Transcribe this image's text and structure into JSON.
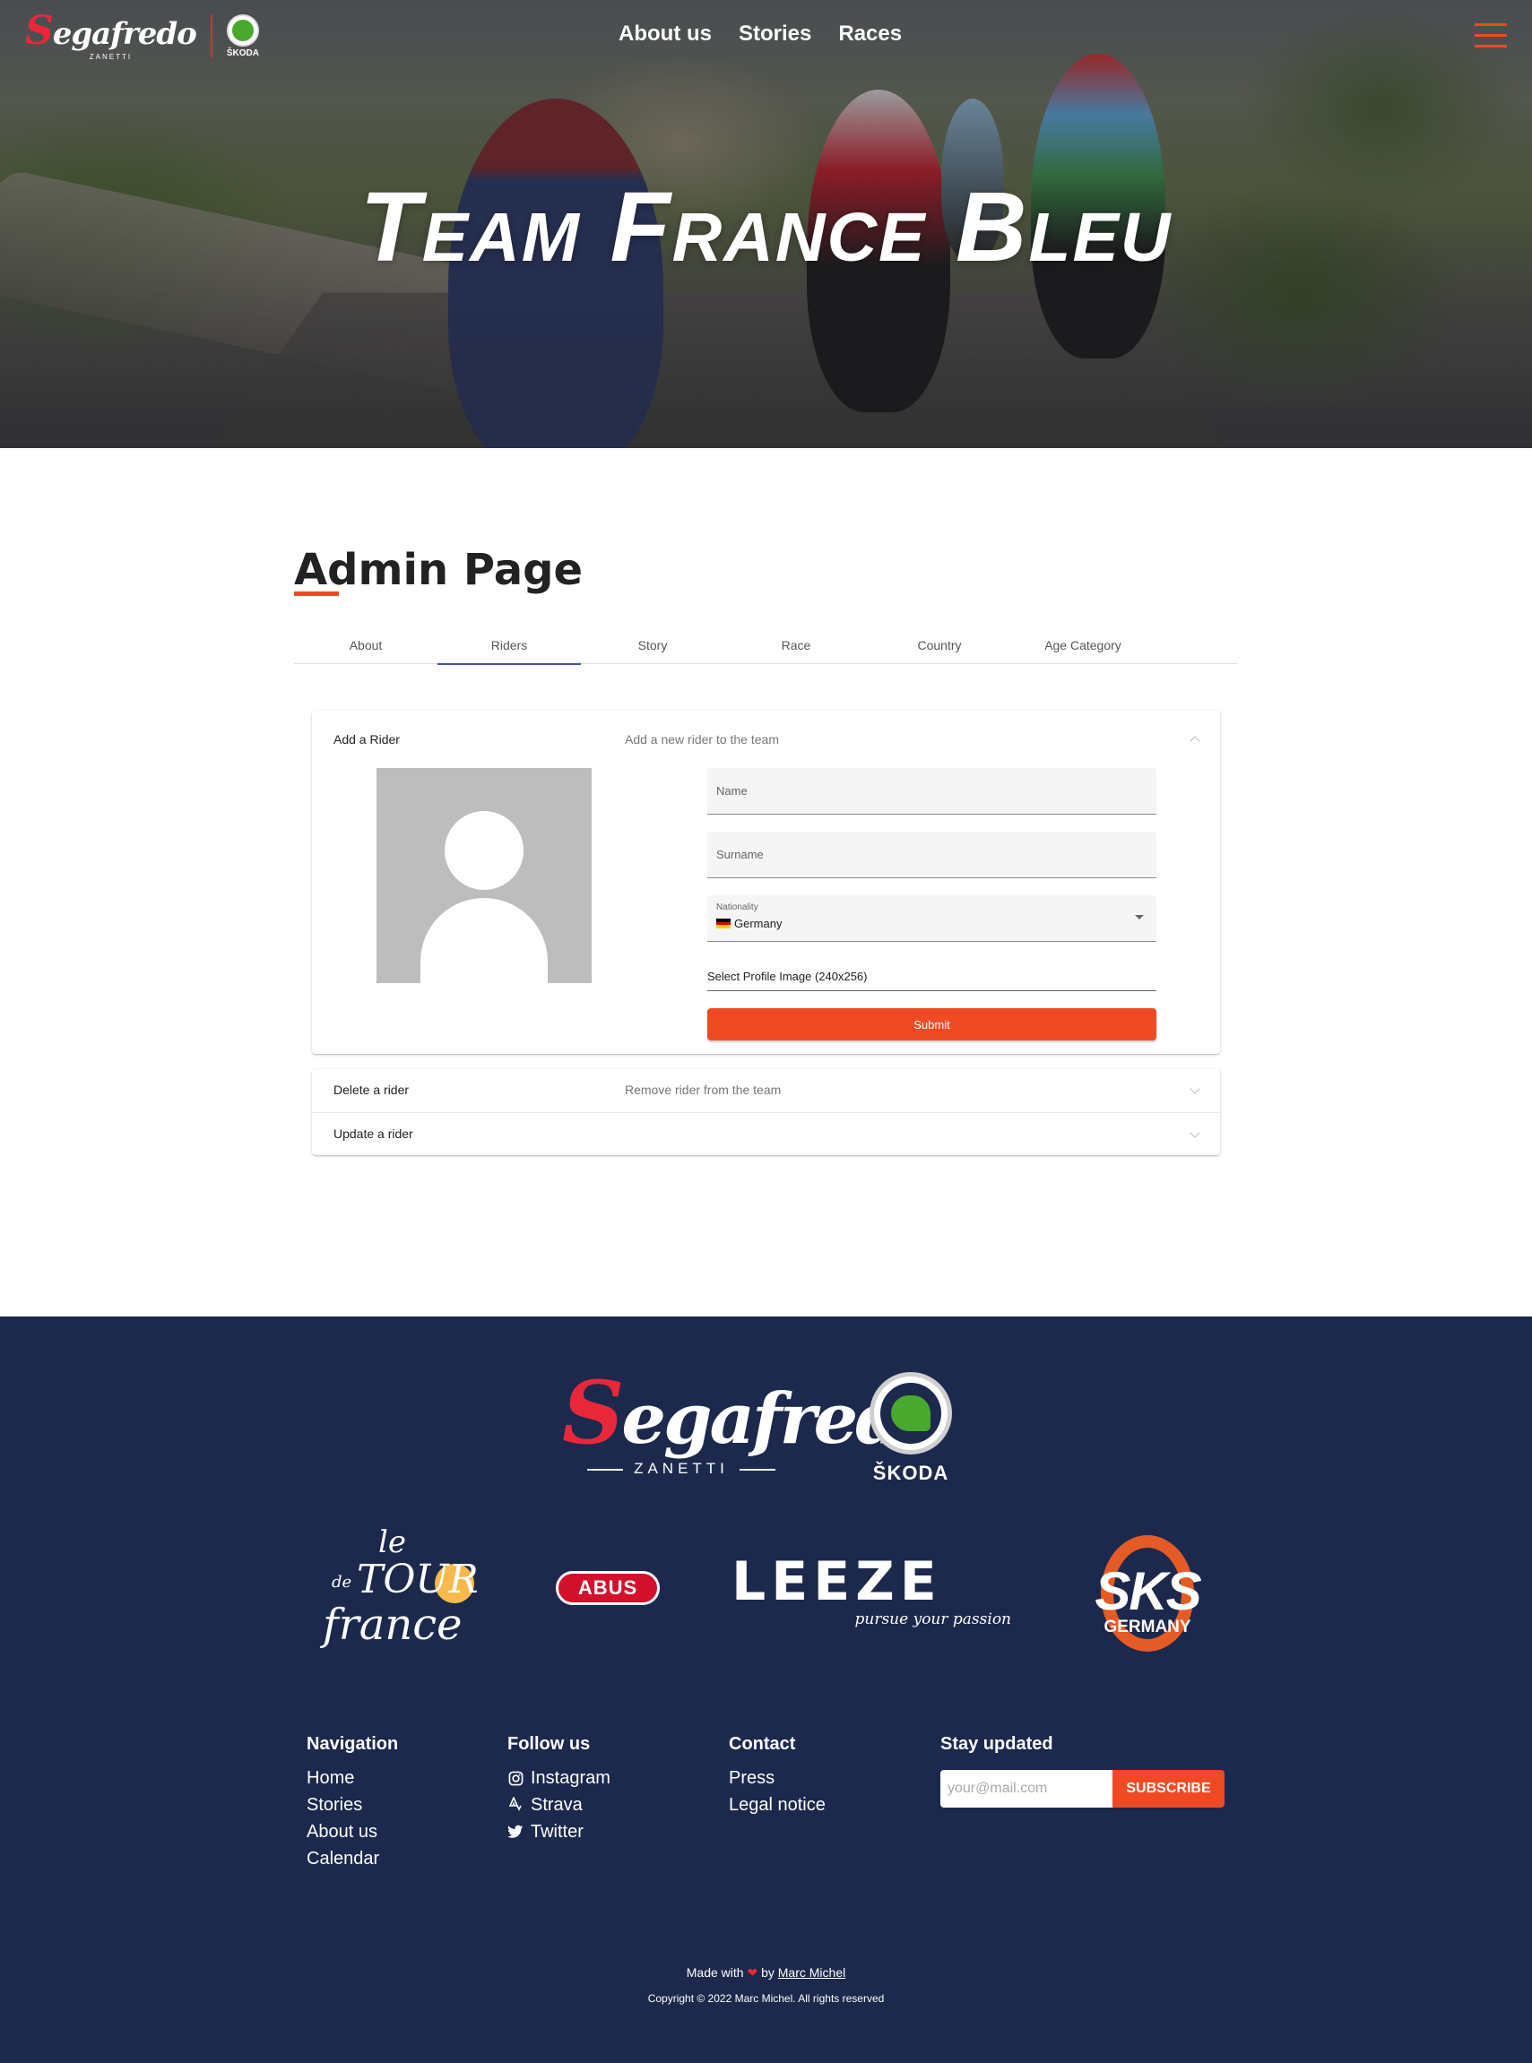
{
  "header": {
    "brand_main": "egafredo",
    "brand_initial": "S",
    "brand_sub": "ZANETTI",
    "partner_name": "ŠKODA",
    "nav": [
      "About us",
      "Stories",
      "Races"
    ],
    "hero_title": "Team France Bleu"
  },
  "main": {
    "page_title": "Admin Page",
    "tabs": [
      "About",
      "Riders",
      "Story",
      "Race",
      "Country",
      "Age Category"
    ],
    "active_tab": "Riders",
    "add_rider": {
      "title": "Add a Rider",
      "description": "Add a new rider to the team",
      "name_placeholder": "Name",
      "surname_placeholder": "Surname",
      "nationality_label": "Nationality",
      "nationality_value": "Germany",
      "image_label": "Select Profile Image (240x256)",
      "submit_label": "Submit"
    },
    "delete_rider": {
      "title": "Delete a rider",
      "description": "Remove rider from the team"
    },
    "update_rider": {
      "title": "Update a rider"
    }
  },
  "footer": {
    "sponsors": {
      "segafredo_initial": "S",
      "segafredo_main": "egafredo",
      "segafredo_sub": "ZANETTI",
      "skoda": "ŠKODA",
      "tdf_le": "le",
      "tdf_de": "de",
      "tdf_tour": "TOUR",
      "tdf_france": "france",
      "abus": "ABUS",
      "leeze": "LEEZE",
      "leeze_tag": "pursue your passion",
      "sks": "SKS",
      "sks_sub": "GERMANY"
    },
    "navigation": {
      "heading": "Navigation",
      "links": [
        "Home",
        "Stories",
        "About us",
        "Calendar"
      ]
    },
    "follow": {
      "heading": "Follow us",
      "links": [
        "Instagram",
        "Strava",
        "Twitter"
      ]
    },
    "contact": {
      "heading": "Contact",
      "links": [
        "Press",
        "Legal notice"
      ]
    },
    "newsletter": {
      "heading": "Stay updated",
      "placeholder": "your@mail.com",
      "button": "SUBSCRIBE"
    },
    "made_with_prefix": "Made with",
    "made_with_by": "by",
    "author": "Marc Michel",
    "copyright": "Copyright © 2022 Marc Michel. All rights reserved"
  },
  "colors": {
    "accent": "#f04a25",
    "footer_bg": "#1c294d",
    "tab_indicator": "#3f51b5"
  }
}
